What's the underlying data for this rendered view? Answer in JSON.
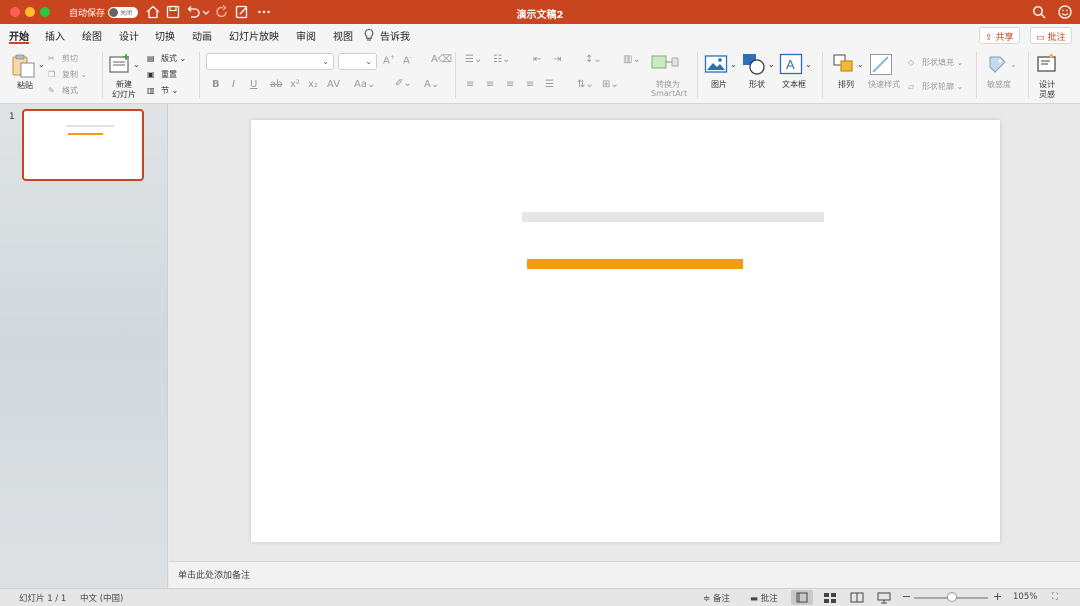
{
  "window": {
    "title": "演示文稿2",
    "autosave_label": "自动保存",
    "autosave_state": "关闭"
  },
  "tabs": [
    "开始",
    "插入",
    "绘图",
    "设计",
    "切换",
    "动画",
    "幻灯片放映",
    "审阅",
    "视图"
  ],
  "tell_me": "告诉我",
  "header_buttons": {
    "share": "共享",
    "comments": "批注"
  },
  "ribbon": {
    "paste": "粘贴",
    "cut": "剪切",
    "copy": "复制",
    "format": "格式",
    "new_slide_line1": "新建",
    "new_slide_line2": "幻灯片",
    "layout": "版式",
    "reset": "重置",
    "section": "节",
    "font_name": "",
    "font_size": "",
    "convert_line1": "转换为",
    "convert_line2": "SmartArt",
    "picture": "图片",
    "shapes": "形状",
    "textbox": "文本框",
    "arrange": "排列",
    "quick_styles": "快速样式",
    "shape_fill": "形状填充",
    "shape_outline": "形状轮廓",
    "sensitivity": "敏感度",
    "designer_line1": "设计",
    "designer_line2": "灵感"
  },
  "thumbnails": [
    {
      "number": "1"
    }
  ],
  "notes_placeholder": "单击此处添加备注",
  "status": {
    "slide_info": "幻灯片 1 / 1",
    "language": "中文 (中国)",
    "notes": "备注",
    "comments": "批注",
    "zoom": "105%"
  },
  "colors": {
    "accent": "#c8451f",
    "placeholder_title": "#e6e6e6",
    "placeholder_subtitle": "#f39c12"
  }
}
